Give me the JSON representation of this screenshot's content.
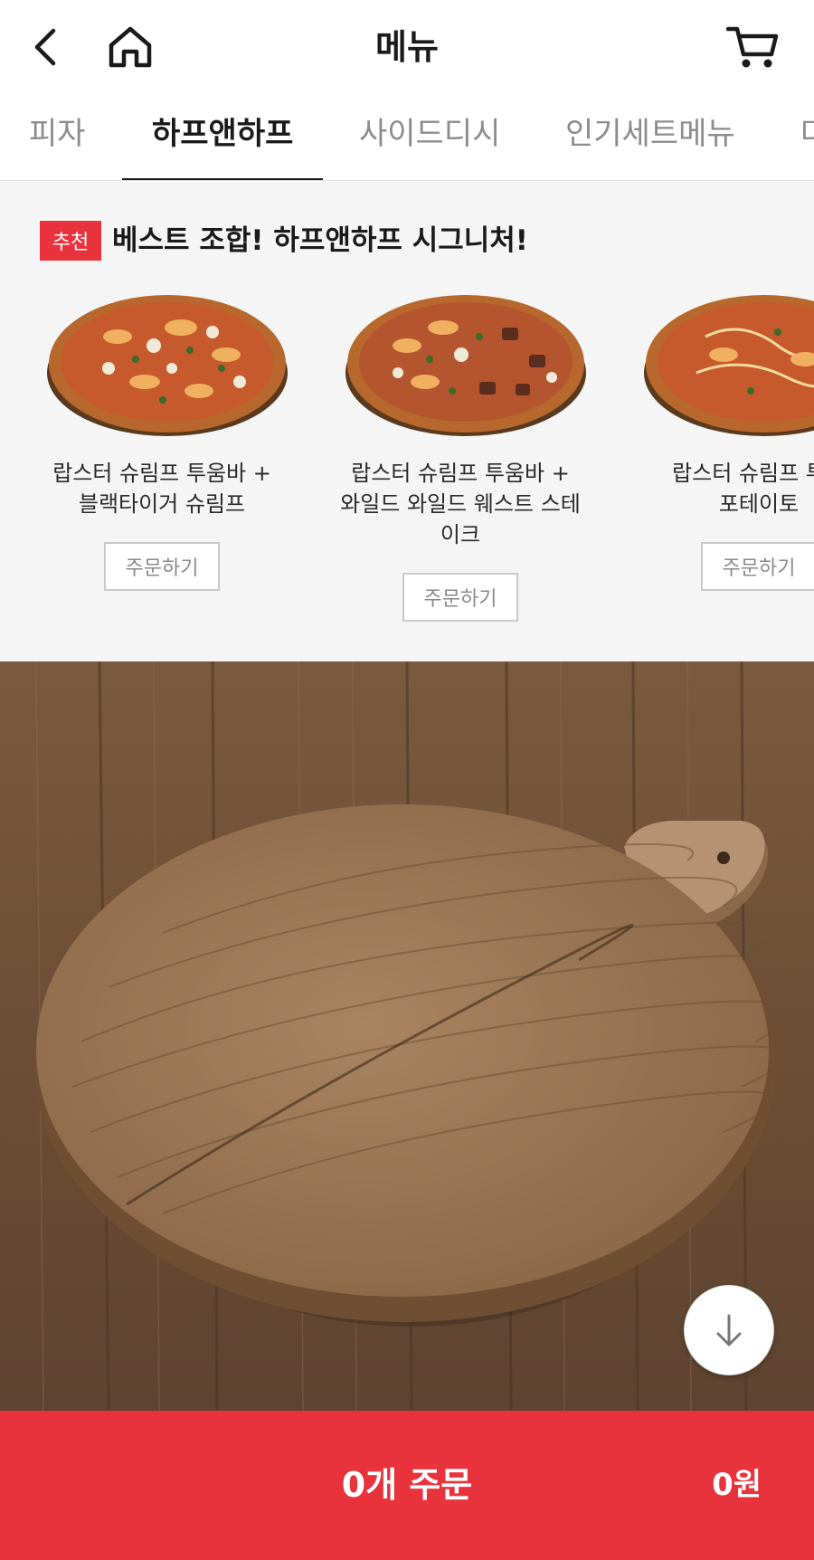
{
  "header": {
    "title": "메뉴",
    "back_icon": "chevron-left-icon",
    "home_icon": "home-icon",
    "cart_icon": "cart-icon"
  },
  "tabs": [
    {
      "label": "피자",
      "active": false
    },
    {
      "label": "하프앤하프",
      "active": true
    },
    {
      "label": "사이드디시",
      "active": false
    },
    {
      "label": "인기세트메뉴",
      "active": false
    },
    {
      "label": "다",
      "active": false
    }
  ],
  "recommendation": {
    "badge": "추천",
    "title": "베스트 조합! 하프앤하프 시그니처!",
    "items": [
      {
        "name_line1": "랍스터 슈림프 투움바 +",
        "name_line2": "블랙타이거 슈림프",
        "name_line3": "",
        "order_label": "주문하기"
      },
      {
        "name_line1": "랍스터 슈림프 투움바 +",
        "name_line2": "와일드 와일드 웨스트 스테",
        "name_line3": "이크",
        "order_label": "주문하기"
      },
      {
        "name_line1": "랍스터 슈림프 투움",
        "name_line2": "포테이토",
        "name_line3": "",
        "order_label": "주문하기"
      }
    ]
  },
  "bottom_bar": {
    "order_count": "0개 주문",
    "total": "0원"
  },
  "colors": {
    "accent": "#e8323c",
    "section_bg": "#f5f5f5",
    "wood": "#8a6b4c"
  }
}
